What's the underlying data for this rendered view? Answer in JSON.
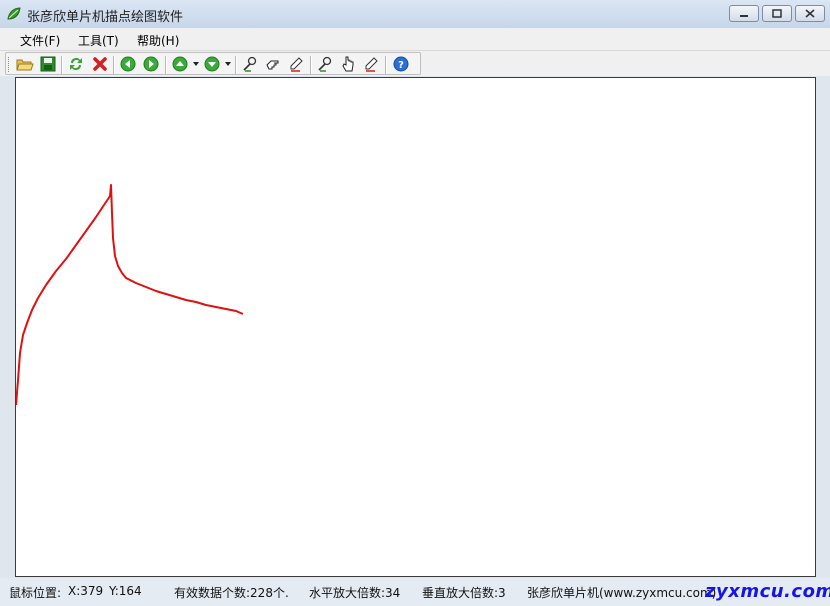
{
  "window": {
    "title": "张彦欣单片机描点绘图软件"
  },
  "menu": {
    "items": [
      {
        "label": "文件(F)"
      },
      {
        "label": "工具(T)"
      },
      {
        "label": "帮助(H)"
      }
    ]
  },
  "toolbar": {
    "icons": [
      "open-folder-icon",
      "save-icon",
      "refresh-icon",
      "delete-icon",
      "back-icon",
      "forward-icon",
      "up-icon",
      "down-icon",
      "zoom-tool-icon",
      "hand-pan-icon",
      "erase-tool-icon",
      "zoom-tool-2-icon",
      "pointer-hand-icon",
      "erase-tool-2-icon",
      "help-icon"
    ]
  },
  "colors": {
    "plot_line": "#e01010",
    "watermark": "#1515e6"
  },
  "chart_data": {
    "type": "line",
    "title": "",
    "xlabel": "",
    "ylabel": "",
    "grid": false,
    "legend": "none",
    "series": [
      {
        "color": "#e01010",
        "points": [
          [
            0,
            327
          ],
          [
            2,
            302
          ],
          [
            4,
            275
          ],
          [
            7,
            257
          ],
          [
            11,
            245
          ],
          [
            16,
            232
          ],
          [
            22,
            220
          ],
          [
            30,
            207
          ],
          [
            40,
            193
          ],
          [
            50,
            181
          ],
          [
            60,
            167
          ],
          [
            70,
            153
          ],
          [
            80,
            139
          ],
          [
            88,
            127
          ],
          [
            94,
            118
          ],
          [
            95,
            107
          ],
          [
            96,
            135
          ],
          [
            97,
            160
          ],
          [
            99,
            178
          ],
          [
            102,
            188
          ],
          [
            106,
            195
          ],
          [
            110,
            200
          ],
          [
            120,
            205
          ],
          [
            130,
            209
          ],
          [
            140,
            213
          ],
          [
            150,
            216
          ],
          [
            160,
            219
          ],
          [
            170,
            222
          ],
          [
            180,
            224
          ],
          [
            190,
            227
          ],
          [
            200,
            229
          ],
          [
            210,
            231
          ],
          [
            220,
            233
          ],
          [
            227,
            236
          ]
        ]
      }
    ]
  },
  "status": {
    "mouse_label": "鼠标位置:",
    "x_text": "X:379",
    "y_text": "Y:164",
    "valid_count": "有效数据个数:228个.",
    "h_zoom": "水平放大倍数:34",
    "v_zoom": "垂直放大倍数:3",
    "author": "张彦欣单片机(www.zyxmcu.com)",
    "watermark": "zyxmcu.com"
  }
}
